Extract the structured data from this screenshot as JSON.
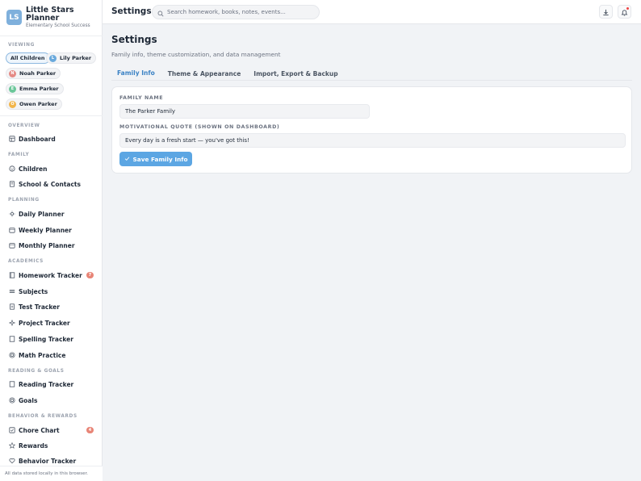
{
  "brand": {
    "logo": "LS",
    "title": "Little Stars Planner",
    "subtitle": "Elementary School Success"
  },
  "viewing": {
    "label": "Viewing",
    "chips": [
      {
        "label": "All Children",
        "active": true
      },
      {
        "initial": "L",
        "label": "Lily Parker",
        "color": "#6aa9dc"
      },
      {
        "initial": "N",
        "label": "Noah Parker",
        "color": "#e58a85"
      },
      {
        "initial": "E",
        "label": "Emma Parker",
        "color": "#6cc79a"
      },
      {
        "initial": "O",
        "label": "Owen Parker",
        "color": "#f2b54a"
      }
    ]
  },
  "nav": {
    "overview": {
      "label": "Overview",
      "items": [
        {
          "label": "Dashboard",
          "icon": "dashboard-icon"
        }
      ]
    },
    "family": {
      "label": "Family",
      "items": [
        {
          "label": "Children",
          "icon": "children-icon"
        },
        {
          "label": "School & Contacts",
          "icon": "school-icon"
        }
      ]
    },
    "planning": {
      "label": "Planning",
      "items": [
        {
          "label": "Daily Planner",
          "icon": "sun-icon"
        },
        {
          "label": "Weekly Planner",
          "icon": "calendar-icon"
        },
        {
          "label": "Monthly Planner",
          "icon": "calendar-icon"
        }
      ]
    },
    "academics": {
      "label": "Academics",
      "items": [
        {
          "label": "Homework Tracker",
          "icon": "homework-icon",
          "badge": "7"
        },
        {
          "label": "Subjects",
          "icon": "subjects-icon"
        },
        {
          "label": "Test Tracker",
          "icon": "test-icon"
        },
        {
          "label": "Project Tracker",
          "icon": "sparkle-icon"
        },
        {
          "label": "Spelling Tracker",
          "icon": "book-icon"
        },
        {
          "label": "Math Practice",
          "icon": "target-icon"
        }
      ]
    },
    "reading": {
      "label": "Reading & Goals",
      "items": [
        {
          "label": "Reading Tracker",
          "icon": "book-icon"
        },
        {
          "label": "Goals",
          "icon": "target-icon"
        }
      ]
    },
    "behavior": {
      "label": "Behavior & Rewards",
      "items": [
        {
          "label": "Chore Chart",
          "icon": "checkbox-icon",
          "badge": "4"
        },
        {
          "label": "Rewards",
          "icon": "star-icon"
        },
        {
          "label": "Behavior Tracker",
          "icon": "heart-icon"
        }
      ]
    }
  },
  "footer": {
    "text": "All data stored locally in this browser."
  },
  "topbar": {
    "title": "Settings",
    "search_placeholder": "Search homework, books, notes, events..."
  },
  "main": {
    "title": "Settings",
    "subtitle": "Family info, theme customization, and data management",
    "tabs": [
      {
        "label": "Family Info",
        "active": true
      },
      {
        "label": "Theme & Appearance"
      },
      {
        "label": "Import, Export & Backup"
      }
    ],
    "form": {
      "family_name_label": "Family Name",
      "family_name_value": "The Parker Family",
      "quote_label": "Motivational Quote (shown on dashboard)",
      "quote_value": "Every day is a fresh start — you've got this!",
      "save_label": "Save Family Info"
    }
  },
  "colors": {
    "accent": "#5ca6e3",
    "tab_active": "#3b82c4",
    "badge": "#e88577"
  }
}
